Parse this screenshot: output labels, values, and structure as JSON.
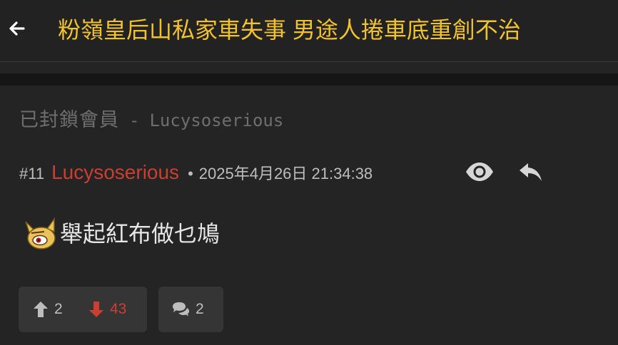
{
  "header": {
    "back_icon": "arrow-left-icon",
    "title": "粉嶺皇后山私家車失事 男途人捲車底重創不治"
  },
  "blocked": {
    "label": "已封鎖會員",
    "separator": "-",
    "username": "Lucysoserious"
  },
  "post": {
    "number": "#11",
    "author": "Lucysoserious",
    "separator": "•",
    "timestamp": "2025年4月26日 21:34:38",
    "icons": {
      "view": "eye-icon",
      "reply": "reply-arrow-icon"
    },
    "emoji": "pixel-art-emoji",
    "content": "舉起紅布做乜鳩"
  },
  "actions": {
    "upvotes": "2",
    "downvotes": "43",
    "comments": "2"
  },
  "colors": {
    "title": "#f1c230",
    "author": "#cb3f33",
    "downvote": "#cb3f33",
    "background": "#242424",
    "button_bg": "#353535"
  }
}
